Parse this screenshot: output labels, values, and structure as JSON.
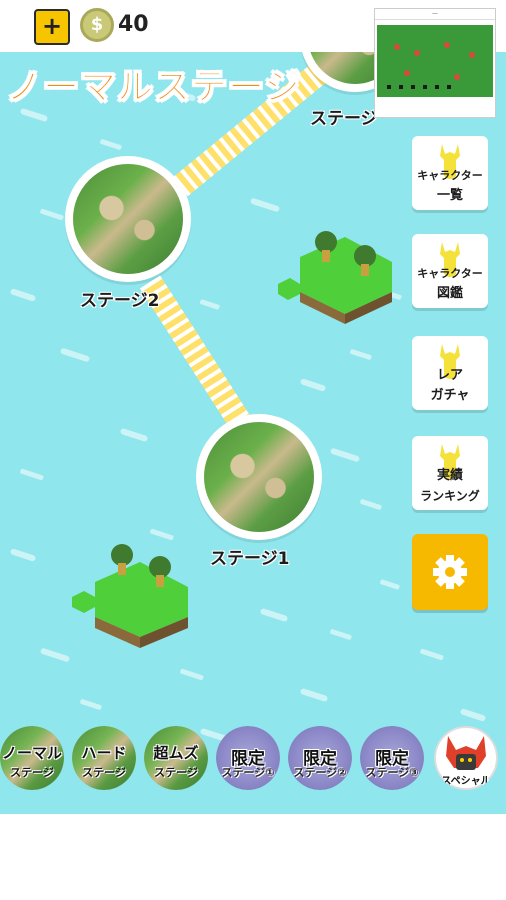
{
  "header": {
    "plus_label": "+",
    "coin_symbol": "$",
    "coins": "40"
  },
  "title": "ノーマルステージ",
  "preview": {
    "caption": "—"
  },
  "stages": [
    {
      "label": "ステージ"
    },
    {
      "label": "ステージ2"
    },
    {
      "label": "ステージ1"
    }
  ],
  "side_buttons": [
    {
      "line1": "キャラクター",
      "line2": "一覧"
    },
    {
      "line1": "キャラクター",
      "line2": "図鑑"
    },
    {
      "line1": "レア",
      "line2": "ガチャ"
    },
    {
      "line1": "実績",
      "line2": "ランキング"
    }
  ],
  "settings_icon": "gear-icon",
  "tabs": [
    {
      "line1": "ノーマル",
      "line2": "ステージ",
      "style": "green"
    },
    {
      "line1": "ハード",
      "line2": "ステージ",
      "style": "green"
    },
    {
      "line1": "超ムズ",
      "line2": "ステージ",
      "style": "green"
    },
    {
      "line1": "限定",
      "line2": "ステージ①",
      "style": "purple"
    },
    {
      "line1": "限定",
      "line2": "ステージ②",
      "style": "purple"
    },
    {
      "line1": "限定",
      "line2": "ステージ③",
      "style": "purple"
    },
    {
      "line1": "",
      "line2": "スペシャル",
      "style": "special"
    }
  ],
  "colors": {
    "sea": "#8fe6ec",
    "accent_yellow": "#f7b800",
    "title_orange": "#f08a10",
    "path_yellow": "#ffe06a"
  }
}
